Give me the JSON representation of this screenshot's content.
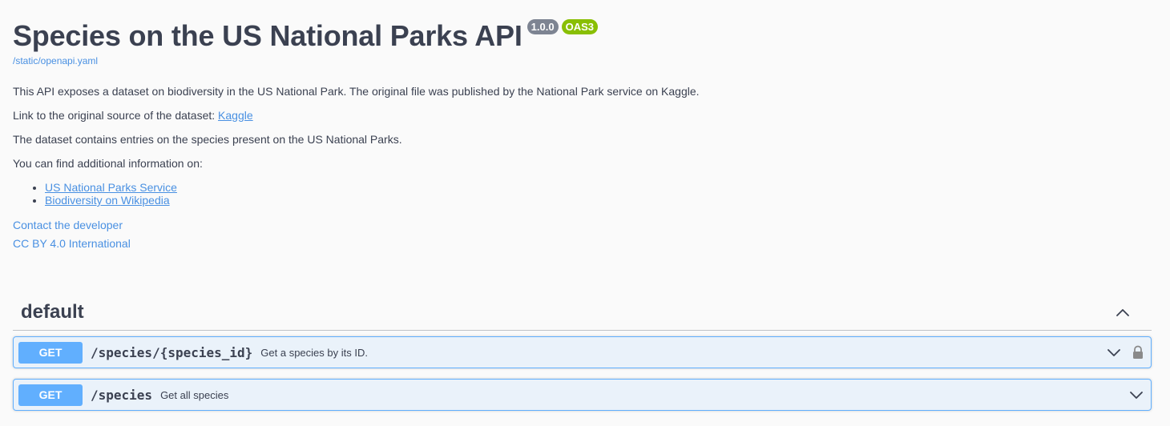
{
  "info": {
    "title": "Species on the US National Parks API",
    "version": "1.0.0",
    "oas_badge": "OAS3",
    "spec_url": "/static/openapi.yaml"
  },
  "description": {
    "p1": "This API exposes a dataset on biodiversity in the US National Park. The original file was published by the National Park service on Kaggle.",
    "p2_prefix": "Link to the original source of the dataset: ",
    "p2_link": "Kaggle",
    "p3": "The dataset contains entries on the species present on the US National Parks.",
    "p4": "You can find additional information on:",
    "links": [
      "US National Parks Service",
      "Biodiversity on Wikipedia"
    ]
  },
  "contact": {
    "developer": "Contact the developer",
    "license": "CC BY 4.0 International"
  },
  "tag": {
    "name": "default",
    "operations": [
      {
        "method": "GET",
        "path": "/species/{species_id}",
        "summary": "Get a species by its ID.",
        "locked": true
      },
      {
        "method": "GET",
        "path": "/species",
        "summary": "Get all species",
        "locked": false
      }
    ]
  },
  "colors": {
    "get_method": "#61affe",
    "link": "#4990e2",
    "version_badge": "#7d8492",
    "oas_badge": "#89bf04"
  }
}
